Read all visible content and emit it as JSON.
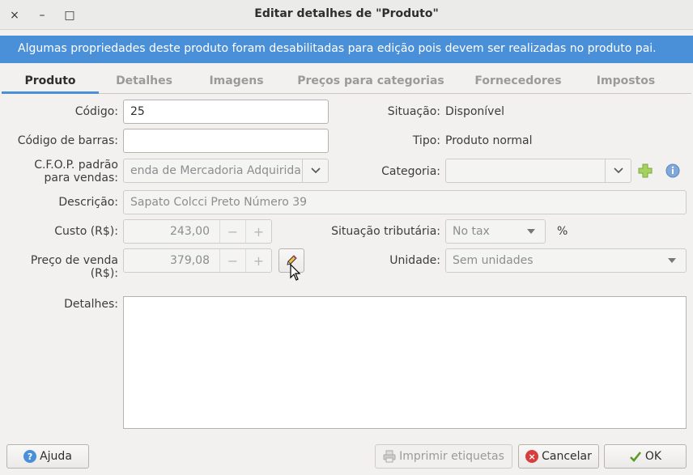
{
  "window": {
    "title": "Editar detalhes de \"Produto\"",
    "close_glyph": "×",
    "minimize_glyph": "–",
    "maximize_glyph": "□"
  },
  "infobar": {
    "message": "Algumas propriedades deste produto foram desabilitadas para edição pois devem ser realizadas no produto pai."
  },
  "tabs": [
    {
      "label": "Produto",
      "active": true
    },
    {
      "label": "Detalhes",
      "active": false
    },
    {
      "label": "Imagens",
      "active": false
    },
    {
      "label": "Preços para categorias",
      "active": false
    },
    {
      "label": "Fornecedores",
      "active": false
    },
    {
      "label": "Impostos",
      "active": false
    }
  ],
  "form": {
    "codigo": {
      "label": "Código:",
      "value": "25"
    },
    "codigo_barras": {
      "label": "Código de barras:",
      "value": ""
    },
    "cfop": {
      "label_line1": "C.F.O.P. padrão",
      "label_line2": "para vendas:",
      "value": "enda de Mercadoria Adquirida"
    },
    "descricao": {
      "label": "Descrição:",
      "value": "Sapato Colcci Preto Número 39"
    },
    "custo": {
      "label": "Custo (R$):",
      "value": "243,00"
    },
    "preco_venda": {
      "label": "Preço de venda (R$):",
      "value": "379,08"
    },
    "detalhes": {
      "label": "Detalhes:",
      "value": ""
    },
    "situacao": {
      "label": "Situação:",
      "value": "Disponível"
    },
    "tipo": {
      "label": "Tipo:",
      "value": "Produto normal"
    },
    "categoria": {
      "label": "Categoria:",
      "value": ""
    },
    "situacao_tributaria": {
      "label": "Situação tributária:",
      "value": "No tax",
      "suffix": "%"
    },
    "unidade": {
      "label": "Unidade:",
      "value": "Sem unidades"
    },
    "spin_minus": "−",
    "spin_plus": "+"
  },
  "buttons": {
    "help": "Ajuda",
    "print_labels": "Imprimir etiquetas",
    "cancel": "Cancelar",
    "ok": "OK"
  },
  "colors": {
    "accent": "#4a90d9",
    "add_icon": "#8ac33e",
    "info_icon": "#4a90d9",
    "cancel_icon": "#d93e3e",
    "ok_icon": "#5b9b26"
  },
  "icons": [
    "close-icon",
    "minimize-icon",
    "maximize-icon",
    "chevron-down-icon",
    "add-icon",
    "info-icon",
    "edit-pencil-icon",
    "help-icon",
    "printer-icon",
    "cancel-icon",
    "checkmark-icon",
    "mouse-pointer-icon"
  ]
}
